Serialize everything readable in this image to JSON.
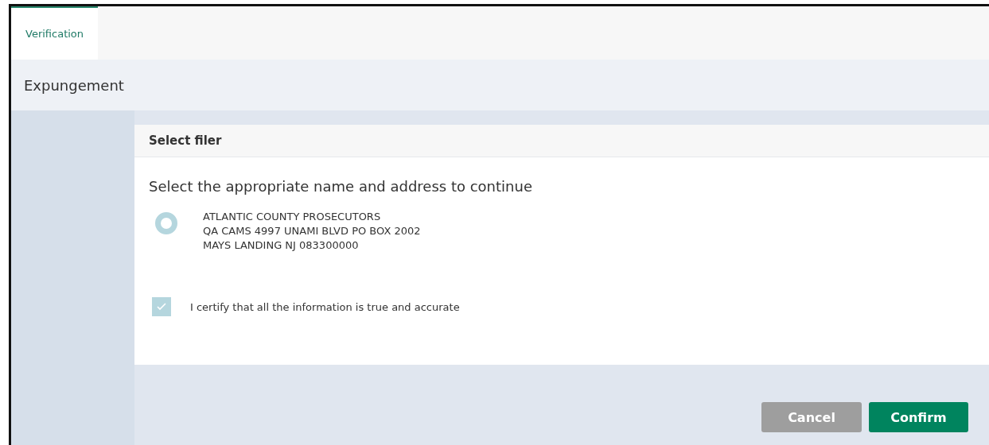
{
  "tabs": [
    {
      "label": "Verification",
      "selected": true
    }
  ],
  "page_title": "Expungement",
  "card": {
    "title": "Select filer",
    "prompt": "Select the appropriate name and address to continue",
    "filers": [
      {
        "lines": [
          "ATLANTIC COUNTY PROSECUTORS",
          "QA CAMS 4997 UNAMI BLVD PO BOX 2002",
          "MAYS LANDING NJ 083300000"
        ],
        "selected": true,
        "disabled": true
      }
    ],
    "certify": {
      "label": "I certify that all the information is true and accurate",
      "checked": true,
      "disabled": true
    }
  },
  "buttons": [
    {
      "label": "Cancel",
      "kind": "secondary"
    },
    {
      "label": "Confirm",
      "kind": "primary"
    }
  ]
}
